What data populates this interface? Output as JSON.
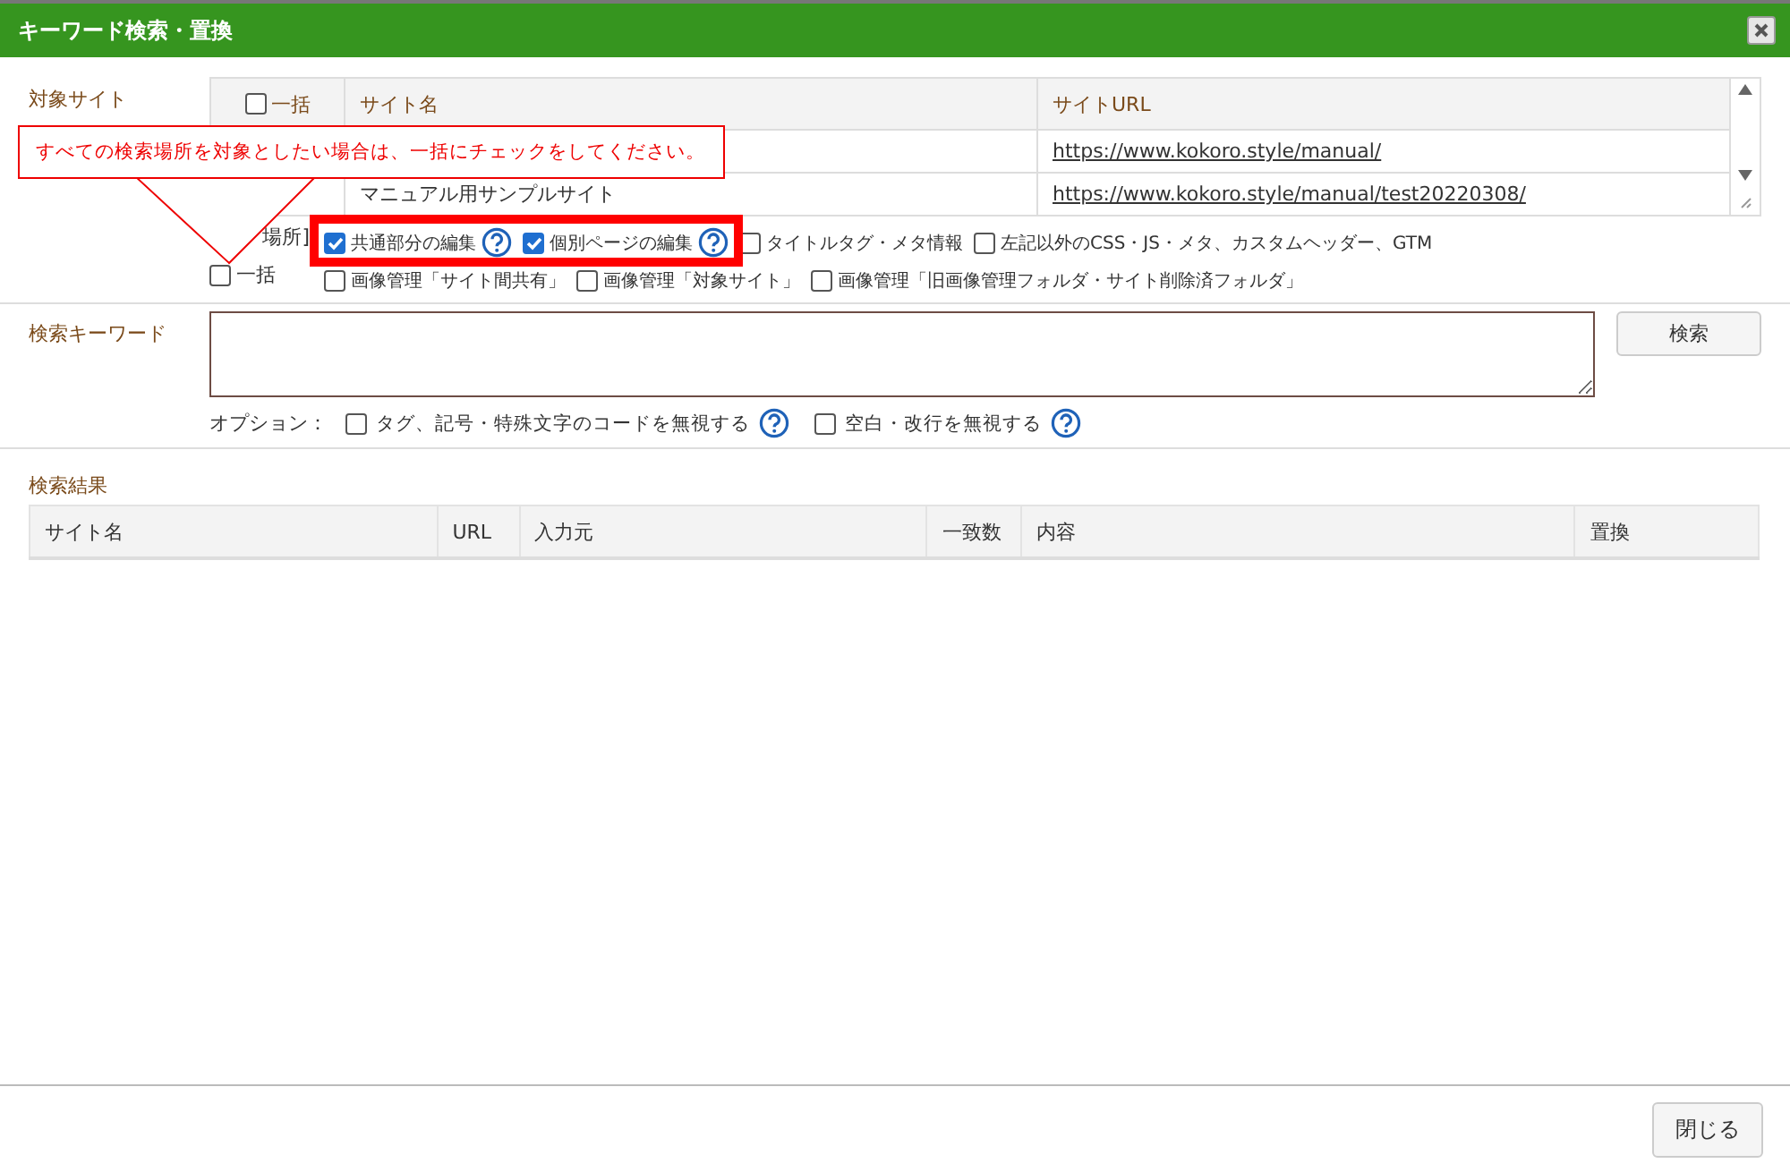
{
  "window": {
    "title": "キーワード検索・置換"
  },
  "target_sites": {
    "label": "対象サイト",
    "select_all": {
      "label": "一括",
      "checked": false
    },
    "columns": [
      "サイト名",
      "サイトURL"
    ],
    "rows": [
      {
        "url": "https://www.kokoro.style/manual/"
      },
      {
        "name": "マニュアル用サンプルサイト",
        "url": "https://www.kokoro.style/manual/test20220308/"
      }
    ]
  },
  "callout": {
    "text": "すべての検索場所を対象としたい場合は、一括にチェックをしてください。"
  },
  "search_location": {
    "label": "場所]",
    "select_all": {
      "label": "一括",
      "checked": false
    },
    "option_rows": [
      [
        {
          "label": "共通部分の編集",
          "checked": true,
          "help": true,
          "highlighted": true
        },
        {
          "label": "個別ページの編集",
          "checked": true,
          "help": true,
          "highlighted": true
        },
        {
          "label": "タイトルタグ・メタ情報",
          "checked": false,
          "help": false,
          "highlighted": false
        },
        {
          "label": "左記以外のCSS・JS・メタ、カスタムヘッダー、GTM",
          "checked": false,
          "help": false,
          "highlighted": false
        }
      ],
      [
        {
          "label": "画像管理「サイト間共有」",
          "checked": false,
          "help": false,
          "highlighted": false
        },
        {
          "label": "画像管理「対象サイト」",
          "checked": false,
          "help": false,
          "highlighted": false
        },
        {
          "label": "画像管理「旧画像管理フォルダ・サイト削除済フォルダ」",
          "checked": false,
          "help": false,
          "highlighted": false
        }
      ]
    ]
  },
  "keyword": {
    "label": "検索キーワード",
    "button": "検索",
    "options_label": "オプション：",
    "options": [
      {
        "label": "タグ、記号・特殊文字のコードを無視する",
        "checked": false,
        "help": true
      },
      {
        "label": "空白・改行を無視する",
        "checked": false,
        "help": true
      }
    ]
  },
  "results": {
    "label": "検索結果",
    "columns": [
      "サイト名",
      "URL",
      "入力元",
      "一致数",
      "内容",
      "置換"
    ]
  },
  "footer": {
    "button": "閉じる"
  }
}
